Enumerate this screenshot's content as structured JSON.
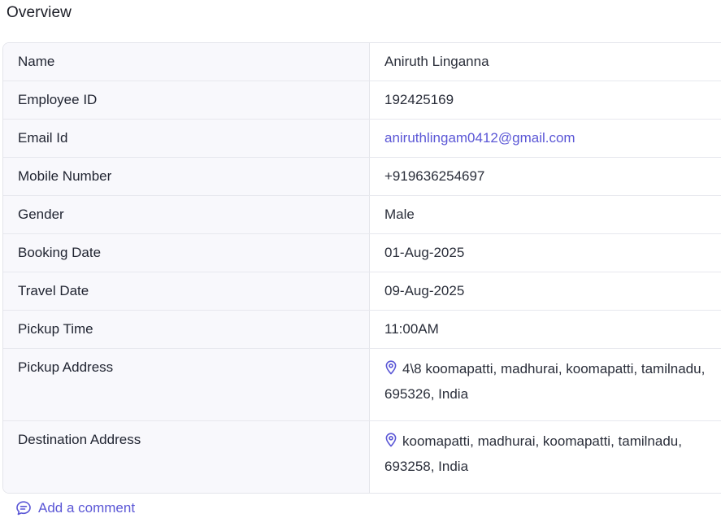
{
  "page": {
    "title": "Overview"
  },
  "details": [
    {
      "label": "Name",
      "value": "Aniruth Linganna"
    },
    {
      "label": "Employee ID",
      "value": "192425169"
    },
    {
      "label": "Email Id",
      "value": "aniruthlingam0412@gmail.com"
    },
    {
      "label": "Mobile Number",
      "value": "+919636254697"
    },
    {
      "label": "Gender",
      "value": "Male"
    },
    {
      "label": "Booking Date",
      "value": "01-Aug-2025"
    },
    {
      "label": "Travel Date",
      "value": "09-Aug-2025"
    },
    {
      "label": "Pickup Time",
      "value": "11:00AM"
    },
    {
      "label": "Pickup Address",
      "value": "4\\8 koomapatti, madhurai, koomapatti, tamilnadu, 695326, India",
      "icon": "location-pin-icon"
    },
    {
      "label": "Destination Address",
      "value": "koomapatti, madhurai, koomapatti, tamilnadu, 693258, India",
      "icon": "location-pin-icon"
    }
  ],
  "actions": {
    "add_comment_label": "Add a comment",
    "add_comment_icon": "comment-icon"
  },
  "colors": {
    "accent": "#5b57d6",
    "label_bg": "#f8f8fc",
    "border": "#e4e5eb"
  }
}
